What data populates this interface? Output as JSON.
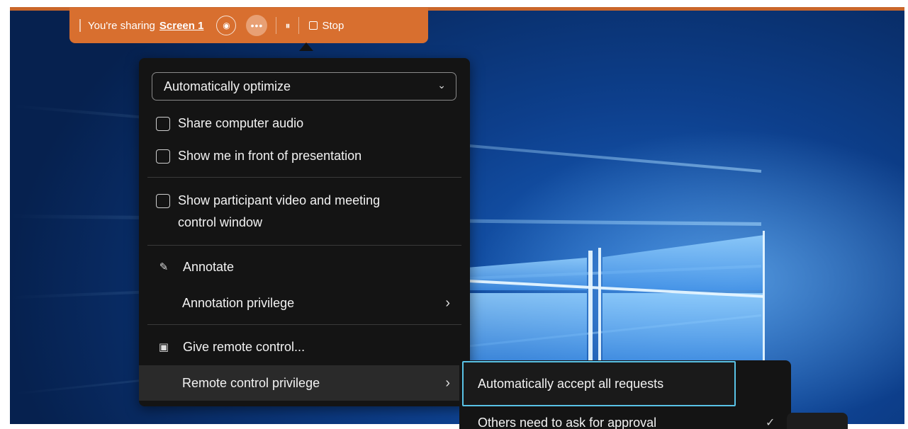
{
  "share_bar": {
    "sharing_prefix": "You're sharing",
    "screen_name": "Screen 1",
    "view_icon": "view-icon",
    "more_icon": "more-options-icon",
    "more_glyph": "•••",
    "pause_icon": "pause-icon",
    "pause_glyph": "⏸",
    "stop_label": "Stop",
    "accent_color": "#d86f2f"
  },
  "menu": {
    "optimize_select": {
      "value": "Automatically optimize"
    },
    "checkboxes": [
      {
        "label": "Share computer audio",
        "checked": false
      },
      {
        "label": "Show me in front of presentation",
        "checked": false
      },
      {
        "label": "Show participant video and meeting",
        "label_line2": "control window",
        "checked": false
      }
    ],
    "annotate": {
      "label": "Annotate",
      "icon": "annotate-icon"
    },
    "annotation_privilege": {
      "label": "Annotation privilege"
    },
    "give_remote_control": {
      "label": "Give remote control...",
      "icon": "remote-control-icon"
    },
    "remote_control_privilege": {
      "label": "Remote control privilege"
    }
  },
  "submenu": {
    "items": [
      {
        "label": "Automatically accept all requests",
        "focused": true
      },
      {
        "label": "Others need to ask for approval",
        "checked": true
      }
    ],
    "focus_color": "#59c2e6"
  }
}
